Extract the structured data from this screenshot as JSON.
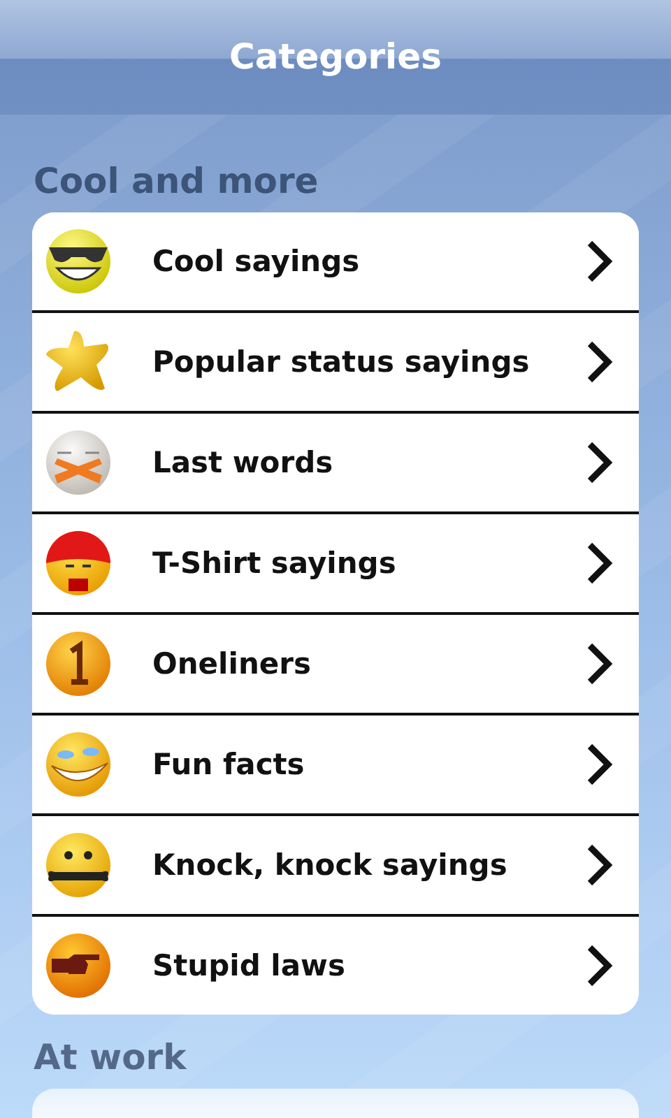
{
  "header": {
    "title": "Categories"
  },
  "sections": [
    {
      "title": "Cool and more",
      "items": [
        {
          "label": "Cool sayings"
        },
        {
          "label": "Popular status sayings"
        },
        {
          "label": "Last words"
        },
        {
          "label": "T-Shirt sayings"
        },
        {
          "label": "Oneliners"
        },
        {
          "label": "Fun facts"
        },
        {
          "label": "Knock, knock sayings"
        },
        {
          "label": "Stupid laws"
        }
      ]
    },
    {
      "title": "At work"
    }
  ]
}
